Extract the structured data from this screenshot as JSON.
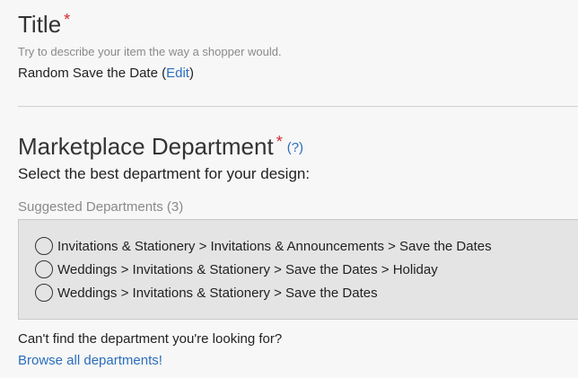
{
  "title_section": {
    "heading": "Title",
    "required_mark": "*",
    "hint": "Try to describe your item the way a shopper would.",
    "value": "Random Save the Date",
    "open_paren": " (",
    "edit_label": "Edit",
    "close_paren": ")"
  },
  "department_section": {
    "heading": "Marketplace Department",
    "required_mark": "*",
    "help_label": "(?)",
    "subtitle": "Select the best department for your design:",
    "suggested_label": "Suggested Departments (3)",
    "options": [
      {
        "label": "Invitations & Stationery > Invitations & Announcements > Save the Dates",
        "selected": false
      },
      {
        "label": "Weddings > Invitations & Stationery > Save the Dates > Holiday",
        "selected": false
      },
      {
        "label": "Weddings > Invitations & Stationery > Save the Dates",
        "selected": false
      }
    ],
    "cant_find": "Can't find the department you're looking for?",
    "browse_link": "Browse all departments!"
  },
  "colors": {
    "link": "#2a6ebb",
    "required": "#d8262f",
    "options_background": "#e4e4e4"
  }
}
